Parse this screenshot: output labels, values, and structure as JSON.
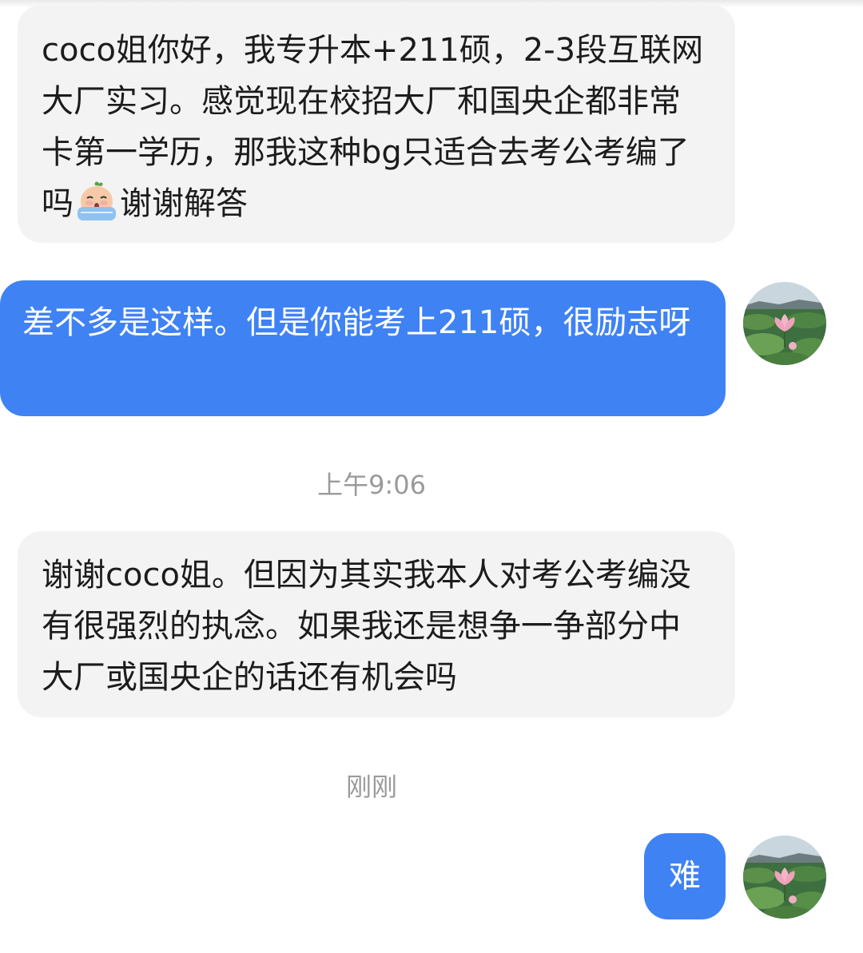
{
  "messages": [
    {
      "sender": "other",
      "text_before_emoji": "coco姐你好，我专升本+211硕，2-3段互联网大厂实习。感觉现在校招大厂和国央企都非常卡第一学历，那我这种bg只适合去考公考编了吗",
      "emoji": "crying-face-emoji",
      "text_after_emoji": "谢谢解答"
    },
    {
      "sender": "self",
      "text": "差不多是这样。但是你能考上211硕，很励志呀"
    },
    {
      "sender": "other",
      "text": "谢谢coco姐。但因为其实我本人对考公考编没有很强烈的执念。如果我还是想争一争部分中大厂或国央企的话还有机会吗"
    },
    {
      "sender": "self",
      "text": "难"
    }
  ],
  "timestamps": {
    "first": "上午9:06",
    "second": "刚刚"
  },
  "avatar": {
    "icon": "lotus-pond-avatar"
  },
  "colors": {
    "incoming_bubble": "#f3f3f3",
    "outgoing_bubble": "#3f82f4",
    "timestamp_text": "#9a9a9a"
  }
}
